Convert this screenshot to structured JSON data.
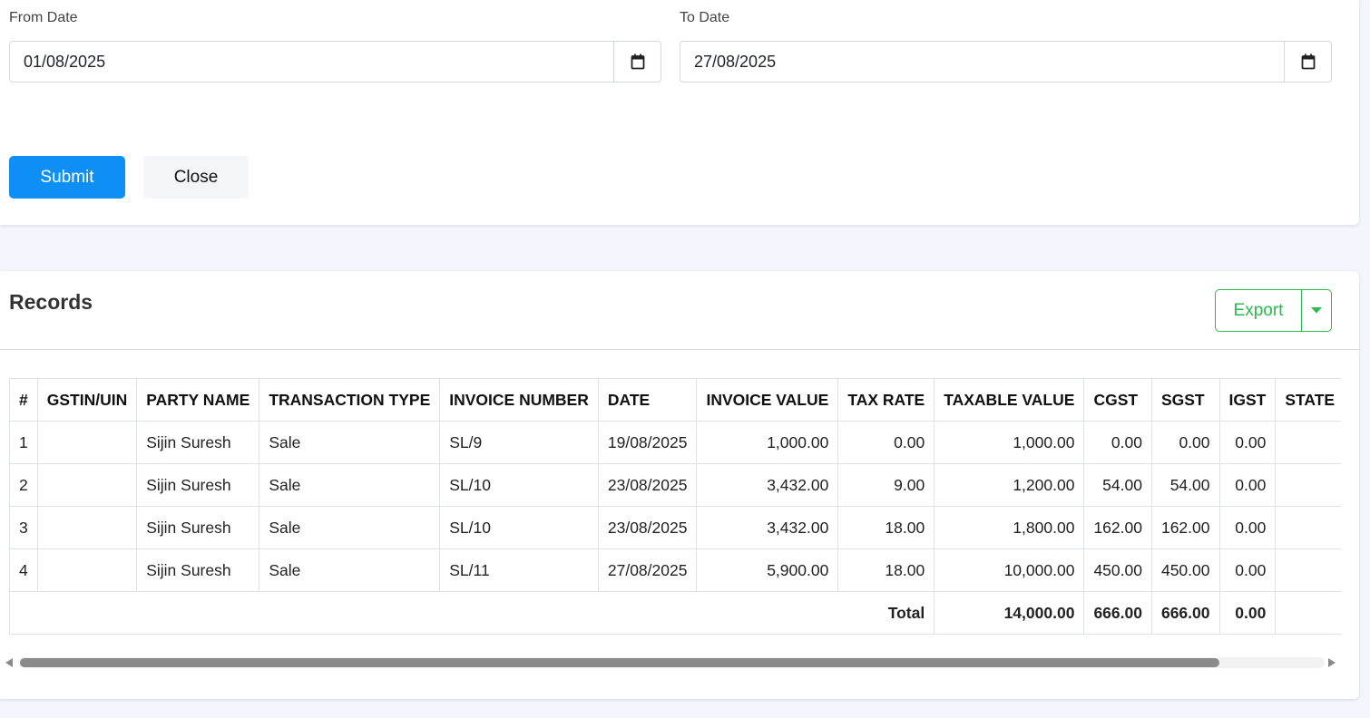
{
  "filters": {
    "from_label": "From Date",
    "from_value": "01/08/2025",
    "to_label": "To Date",
    "to_value": "27/08/2025",
    "submit_label": "Submit",
    "close_label": "Close"
  },
  "records": {
    "title": "Records",
    "export_label": "Export",
    "columns": [
      "#",
      "GSTIN/UIN",
      "PARTY NAME",
      "TRANSACTION TYPE",
      "INVOICE NUMBER",
      "DATE",
      "INVOICE VALUE",
      "TAX RATE",
      "TAXABLE VALUE",
      "CGST",
      "SGST",
      "IGST",
      "STATE"
    ],
    "rows": [
      [
        "1",
        "",
        "Sijin Suresh",
        "Sale",
        "SL/9",
        "19/08/2025",
        "1,000.00",
        "0.00",
        "1,000.00",
        "0.00",
        "0.00",
        "0.00",
        ""
      ],
      [
        "2",
        "",
        "Sijin Suresh",
        "Sale",
        "SL/10",
        "23/08/2025",
        "3,432.00",
        "9.00",
        "1,200.00",
        "54.00",
        "54.00",
        "0.00",
        ""
      ],
      [
        "3",
        "",
        "Sijin Suresh",
        "Sale",
        "SL/10",
        "23/08/2025",
        "3,432.00",
        "18.00",
        "1,800.00",
        "162.00",
        "162.00",
        "0.00",
        ""
      ],
      [
        "4",
        "",
        "Sijin Suresh",
        "Sale",
        "SL/11",
        "27/08/2025",
        "5,900.00",
        "18.00",
        "10,000.00",
        "450.00",
        "450.00",
        "0.00",
        ""
      ]
    ],
    "total": {
      "label": "Total",
      "taxable_value": "14,000.00",
      "cgst": "666.00",
      "sgst": "666.00",
      "igst": "0.00"
    }
  },
  "icons": {
    "calendar": "calendar-icon",
    "caret": "caret-down-icon"
  },
  "colors": {
    "primary": "#0d8ff6",
    "export": "#2db84d",
    "background": "#f5f5fd"
  }
}
